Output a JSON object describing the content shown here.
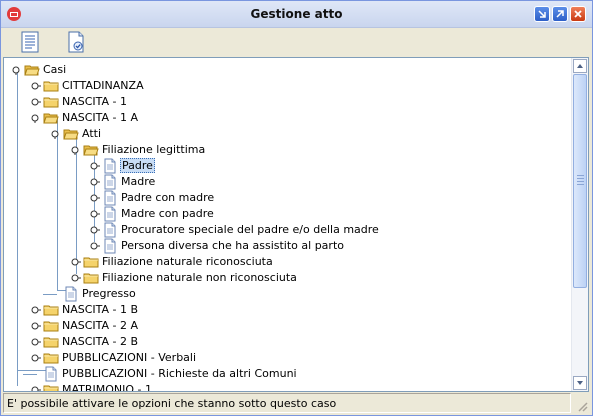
{
  "window": {
    "title": "Gestione atto"
  },
  "toolbar": {
    "buttons": [
      {
        "icon": "document-list-icon"
      },
      {
        "icon": "document-check-icon"
      }
    ]
  },
  "tree": {
    "rows": [
      {
        "label": "Casi",
        "icon": "folder-open",
        "toggle": "expanded",
        "depth": 0
      },
      {
        "label": "CITTADINANZA",
        "icon": "folder",
        "toggle": "collapsed",
        "depth": 1
      },
      {
        "label": "NASCITA - 1",
        "icon": "folder",
        "toggle": "collapsed",
        "depth": 1
      },
      {
        "label": "NASCITA - 1 A",
        "icon": "folder-open",
        "toggle": "expanded",
        "depth": 1
      },
      {
        "label": "Atti",
        "icon": "folder-open",
        "toggle": "expanded",
        "depth": 2
      },
      {
        "label": "Filiazione legittima",
        "icon": "folder-open",
        "toggle": "expanded",
        "depth": 3
      },
      {
        "label": "Padre",
        "icon": "document",
        "toggle": "collapsed",
        "depth": 4,
        "selected": true
      },
      {
        "label": "Madre",
        "icon": "document",
        "toggle": "collapsed",
        "depth": 4
      },
      {
        "label": "Padre con madre",
        "icon": "document",
        "toggle": "collapsed",
        "depth": 4
      },
      {
        "label": "Madre con padre",
        "icon": "document",
        "toggle": "collapsed",
        "depth": 4
      },
      {
        "label": "Procuratore speciale del padre e/o della madre",
        "icon": "document",
        "toggle": "collapsed",
        "depth": 4
      },
      {
        "label": "Persona diversa che ha assistito al parto",
        "icon": "document",
        "toggle": "collapsed",
        "depth": 4
      },
      {
        "label": "Filiazione naturale riconosciuta",
        "icon": "folder",
        "toggle": "collapsed",
        "depth": 3
      },
      {
        "label": "Filiazione naturale non riconosciuta",
        "icon": "folder",
        "toggle": "collapsed",
        "depth": 3
      },
      {
        "label": "Pregresso",
        "icon": "document",
        "toggle": "none",
        "depth": 2
      },
      {
        "label": "NASCITA - 1 B",
        "icon": "folder",
        "toggle": "collapsed",
        "depth": 1
      },
      {
        "label": "NASCITA - 2 A",
        "icon": "folder",
        "toggle": "collapsed",
        "depth": 1
      },
      {
        "label": "NASCITA - 2 B",
        "icon": "folder",
        "toggle": "collapsed",
        "depth": 1
      },
      {
        "label": "PUBBLICAZIONI - Verbali",
        "icon": "folder",
        "toggle": "collapsed",
        "depth": 1
      },
      {
        "label": "PUBBLICAZIONI - Richieste da altri Comuni",
        "icon": "document",
        "toggle": "none",
        "depth": 1
      },
      {
        "label": "MATRIMONIO - 1",
        "icon": "folder",
        "toggle": "collapsed",
        "depth": 1
      }
    ]
  },
  "status": {
    "text": "E' possibile attivare le opzioni che stanno sotto questo caso"
  },
  "colors": {
    "selection": "#c9ddf5",
    "folder": "#f5d36b",
    "tree_line": "#7a9cc4"
  }
}
